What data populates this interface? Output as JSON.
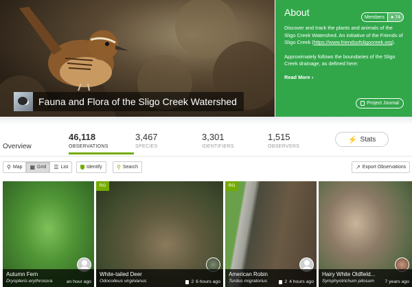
{
  "project": {
    "title": "Fauna and Flora of the Sligo Creek Watershed"
  },
  "about": {
    "heading": "About",
    "members_label": "Members",
    "members_count": "74",
    "para1_text": "Discover and track the plants and animals of the Sligo Creek Watershed. An initiative of the Friends of Sligo Creek (",
    "para1_link": "https://www.friendsofsligocreek.org",
    "para1_end": ").",
    "para2": "Approximately follows the boundaries of the Sligo Creek drainage, as defined here:",
    "read_more": "Read More",
    "read_more_glyph": "›",
    "journal_label": "Project Journal",
    "background_color": "#31a74a"
  },
  "stats": {
    "overview_label": "Overview",
    "items": [
      {
        "num": "46,118",
        "label": "OBSERVATIONS"
      },
      {
        "num": "3,467",
        "label": "SPECIES"
      },
      {
        "num": "3,301",
        "label": "IDENTIFIERS"
      },
      {
        "num": "1,515",
        "label": "OBSERVERS"
      }
    ],
    "stats_button": "Stats",
    "accent": "#74ac00"
  },
  "toolbar": {
    "map": "Map",
    "grid": "Grid",
    "list": "List",
    "identify": "Identify",
    "search": "Search",
    "export": "Export Observations"
  },
  "observations": [
    {
      "name": "Autumn Fern",
      "sci": "Dryopteris erythrosora",
      "time": "an hour ago",
      "count": "",
      "rg": "",
      "avatar": "person-icon"
    },
    {
      "name": "White-tailed Deer",
      "sci": "Odocoileus virginianus",
      "time": "6 hours ago",
      "count": "2",
      "rg": "RG",
      "avatar": "photo"
    },
    {
      "name": "American Robin",
      "sci": "Turdus migratorius",
      "time": "4 hours ago",
      "count": "2",
      "rg": "RG",
      "avatar": "person-icon"
    },
    {
      "name": "Hairy White Oldfield...",
      "sci": "Symphyotrichum pilosum",
      "time": "7 years ago",
      "count": "",
      "rg": "",
      "avatar": "photo"
    }
  ]
}
